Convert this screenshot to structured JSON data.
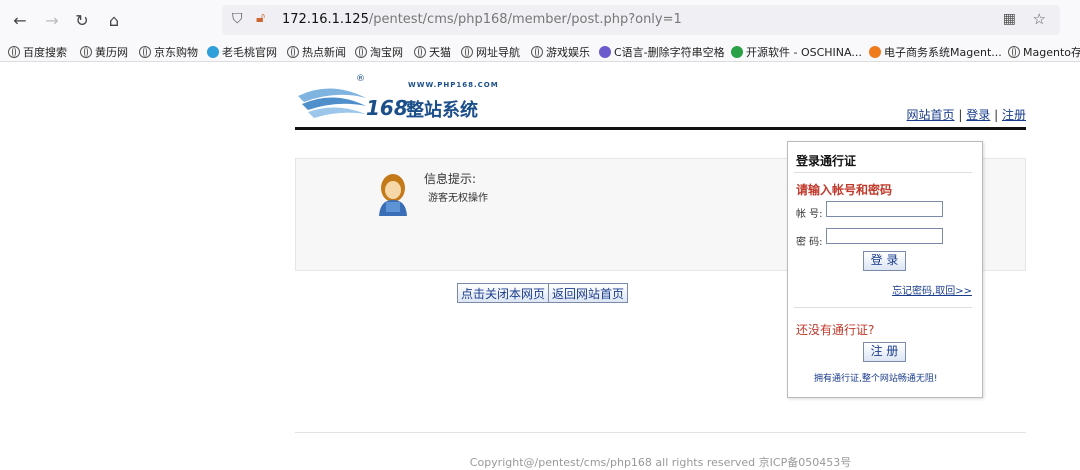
{
  "browser": {
    "url_host": "172.16.1.125",
    "url_path": "/pentest/cms/php168/member/post.php?only=1",
    "icons": {
      "back": "back-arrow-icon",
      "forward": "forward-arrow-icon",
      "reload": "reload-icon",
      "home": "home-icon",
      "shield": "shield-icon",
      "lock": "insecure-lock-icon",
      "qr": "qr-code-icon",
      "star": "bookmark-star-icon"
    }
  },
  "bookmarks": [
    {
      "label": "百度搜索"
    },
    {
      "label": "黄历网"
    },
    {
      "label": "京东购物"
    },
    {
      "label": "老毛桃官网"
    },
    {
      "label": "热点新闻"
    },
    {
      "label": "淘宝网"
    },
    {
      "label": "天猫"
    },
    {
      "label": "网址导航"
    },
    {
      "label": "游戏娱乐"
    },
    {
      "label": "C语言-删除字符串空格"
    },
    {
      "label": "开源软件 - OSCHINA..."
    },
    {
      "label": "电子商务系统Magent..."
    },
    {
      "label": "Magento存"
    }
  ],
  "logo": {
    "site": "WWW.PHP168.COM",
    "num": "168",
    "name": "整站系统",
    "reg": "®"
  },
  "toplinks": {
    "home": "网站首页",
    "login": "登录",
    "register": "注册",
    "sep": "|"
  },
  "message": {
    "title": "信息提示:",
    "text": "游客无权操作"
  },
  "buttons": {
    "close": "点击关闭本网页",
    "back_home": "返回网站首页"
  },
  "login": {
    "heading": "登录通行证",
    "prompt": "请输入帐号和密码",
    "username_label": "帐 号:",
    "password_label": "密 码:",
    "submit": "登 录",
    "forgot": "忘记密码,取回>>",
    "no_account": "还没有通行证?",
    "register": "注 册",
    "tip": "拥有通行证,整个网站畅通无阻!"
  },
  "footer": {
    "text": "Copyright@/pentest/cms/php168 all rights reserved 京ICP备050453号"
  }
}
